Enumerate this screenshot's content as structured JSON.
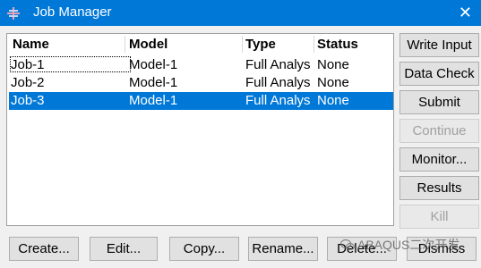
{
  "window": {
    "title": "Job Manager",
    "close_glyph": "✕",
    "icon": "abaqus-app-icon"
  },
  "table": {
    "columns": [
      "Name",
      "Model",
      "Type",
      "Status"
    ],
    "rows": [
      [
        "Job-1",
        "Model-1",
        "Full Analys",
        "None"
      ],
      [
        "Job-2",
        "Model-1",
        "Full Analys",
        "None"
      ],
      [
        "Job-3",
        "Model-1",
        "Full Analys",
        "None"
      ]
    ],
    "selected_row": 2
  },
  "side_buttons": [
    {
      "label": "Write Input",
      "enabled": true
    },
    {
      "label": "Data Check",
      "enabled": true
    },
    {
      "label": "Submit",
      "enabled": true
    },
    {
      "label": "Continue",
      "enabled": false
    },
    {
      "label": "Monitor...",
      "enabled": true
    },
    {
      "label": "Results",
      "enabled": true
    },
    {
      "label": "Kill",
      "enabled": false
    }
  ],
  "bottom_buttons": [
    {
      "label": "Create..."
    },
    {
      "label": "Edit..."
    },
    {
      "label": "Copy..."
    },
    {
      "label": "Rename..."
    },
    {
      "label": "Delete..."
    },
    {
      "label": "Dismiss"
    }
  ],
  "watermark": {
    "text": "ABAQUS二次开发"
  },
  "colors": {
    "titlebar": "#0078d7",
    "selection": "#0078d7"
  }
}
